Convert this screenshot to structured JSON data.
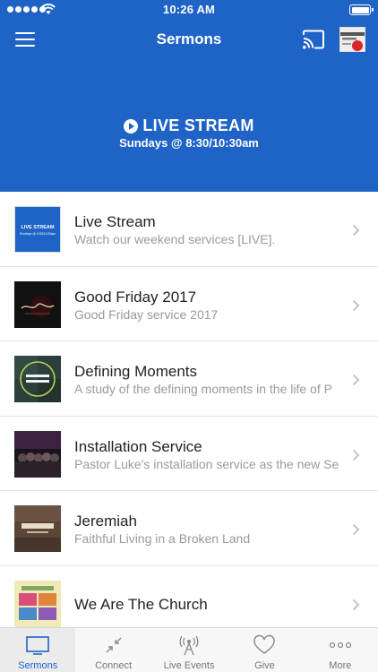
{
  "status_bar": {
    "time": "10:26 AM"
  },
  "nav": {
    "title": "Sermons",
    "menu_icon": "hamburger-icon",
    "cast_icon": "cast-icon",
    "avatar_icon": "profile-avatar"
  },
  "banner": {
    "title": "LIVE STREAM",
    "subtitle": "Sundays @ 8:30/10:30am"
  },
  "thumbnails": {
    "live_title": "LIVE STREAM",
    "live_sub": "Sundays @ 8:30/10:30am"
  },
  "sermons": [
    {
      "title": "Live Stream",
      "subtitle": "Watch our weekend services [LIVE]."
    },
    {
      "title": "Good Friday  2017",
      "subtitle": "Good Friday service 2017"
    },
    {
      "title": "Defining Moments",
      "subtitle": "A study of the defining moments in the life of P"
    },
    {
      "title": "Installation Service",
      "subtitle": "Pastor Luke's installation service as the new Se"
    },
    {
      "title": "Jeremiah",
      "subtitle": "Faithful Living in a Broken Land"
    },
    {
      "title": "We Are The Church",
      "subtitle": ""
    }
  ],
  "tabs": [
    {
      "label": "Sermons",
      "icon": "tv-icon",
      "active": true
    },
    {
      "label": "Connect",
      "icon": "connect-arrows-icon",
      "active": false
    },
    {
      "label": "Live Events",
      "icon": "broadcast-tower-icon",
      "active": false
    },
    {
      "label": "Give",
      "icon": "heart-icon",
      "active": false
    },
    {
      "label": "More",
      "icon": "more-dots-icon",
      "active": false
    }
  ],
  "colors": {
    "brand_blue": "#1f63c6",
    "subtitle_gray": "#9a9a9a",
    "tab_inactive": "#777777"
  }
}
